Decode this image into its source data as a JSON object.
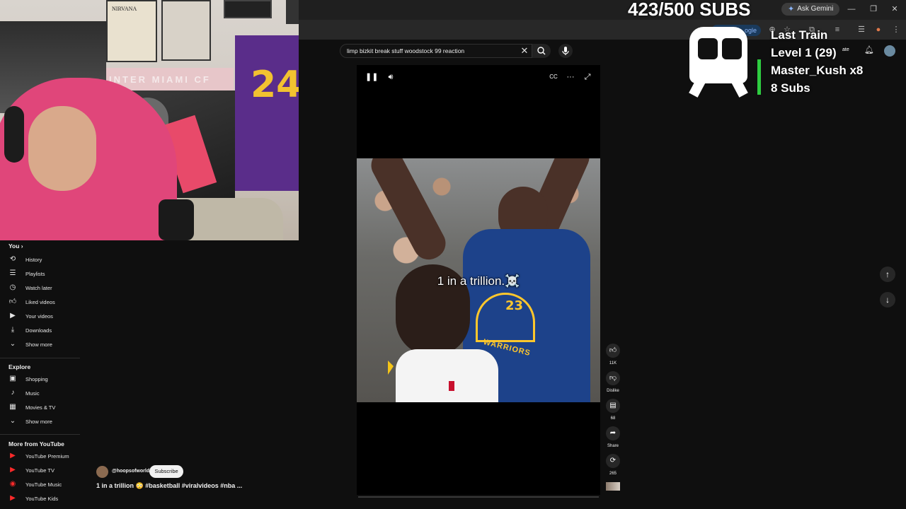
{
  "overlay": {
    "subs_goal": "423/500 SUBS",
    "train_title": "Last Train",
    "train_level": "Level 1  (29)",
    "train_user": "Master_Kush x8",
    "train_subs": "8 Subs"
  },
  "browser": {
    "ask_gemini": "Ask Gemini",
    "addr_pill": "ogle"
  },
  "header": {
    "create_label": "ate"
  },
  "search": {
    "query": "limp bizkit break stuff woodstock 99 reaction"
  },
  "webcam": {
    "poster_text": "NIRVANA",
    "banner_text": "INTER MIAMI CF",
    "jersey_number": "24"
  },
  "sidebar": {
    "you_heading": "You",
    "you_items": [
      {
        "label": "History",
        "icon": "history-icon"
      },
      {
        "label": "Playlists",
        "icon": "playlists-icon"
      },
      {
        "label": "Watch later",
        "icon": "clock-icon"
      },
      {
        "label": "Liked videos",
        "icon": "thumbs-up-icon"
      },
      {
        "label": "Your videos",
        "icon": "play-icon"
      },
      {
        "label": "Downloads",
        "icon": "download-icon"
      },
      {
        "label": "Show more",
        "icon": "chevron-down-icon"
      }
    ],
    "explore_heading": "Explore",
    "explore_items": [
      {
        "label": "Shopping",
        "icon": "shopping-bag-icon"
      },
      {
        "label": "Music",
        "icon": "music-note-icon"
      },
      {
        "label": "Movies & TV",
        "icon": "film-icon"
      },
      {
        "label": "Show more",
        "icon": "chevron-down-icon"
      }
    ],
    "more_heading": "More from YouTube",
    "more_items": [
      {
        "label": "YouTube Premium",
        "icon": "youtube-premium-icon"
      },
      {
        "label": "YouTube TV",
        "icon": "youtube-tv-icon"
      },
      {
        "label": "YouTube Music",
        "icon": "youtube-music-icon"
      },
      {
        "label": "YouTube Kids",
        "icon": "youtube-kids-icon"
      }
    ]
  },
  "video": {
    "caption": "1 in a trillion.☠️",
    "jersey_number": "23",
    "team_text": "WARRIORS",
    "channel": "@hoopsofworld",
    "subscribe": "Subscribe",
    "title": "1 in a trillion 😳 #basketball #viralvideos #nba ..."
  },
  "actions": {
    "likes": "11K",
    "dislike": "Dislike",
    "comments": "68",
    "share": "Share",
    "remix": "265"
  },
  "colors": {
    "accent_green": "#2ecc40",
    "youtube_red": "#ff0000",
    "warriors_blue": "#1d428a",
    "warriors_gold": "#ffc72c"
  }
}
